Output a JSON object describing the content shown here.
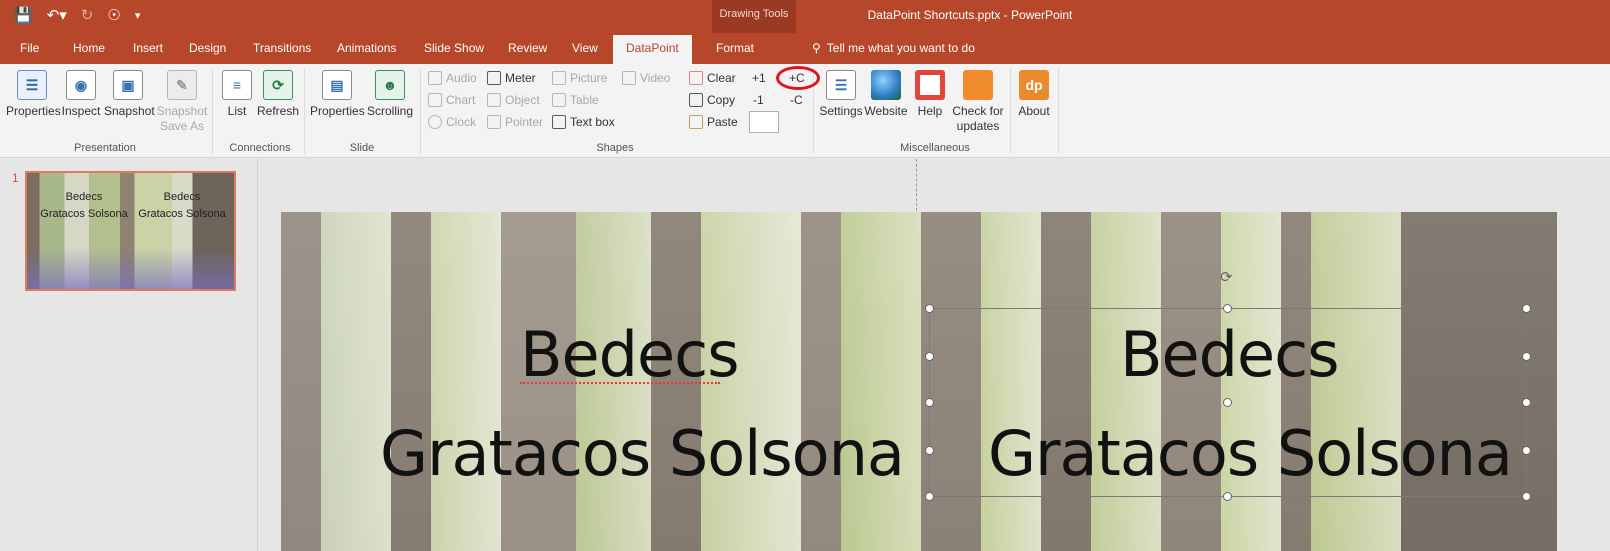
{
  "titlebar": {
    "qat_icons": [
      "save-icon",
      "undo-icon",
      "redo-icon",
      "touch-mode-icon",
      "customize-icon"
    ],
    "context_group": "Drawing Tools",
    "document_title": "DataPoint Shortcuts.pptx - PowerPoint"
  },
  "tabs": {
    "file": "File",
    "home": "Home",
    "insert": "Insert",
    "design": "Design",
    "transitions": "Transitions",
    "animations": "Animations",
    "slideshow": "Slide Show",
    "review": "Review",
    "view": "View",
    "datapoint": "DataPoint",
    "format": "Format",
    "tellme": "Tell me what you want to do"
  },
  "ribbon": {
    "presentation": {
      "label": "Presentation",
      "properties": "Properties",
      "inspect": "Inspect",
      "snapshot": "Snapshot",
      "snapshot_saveas_1": "Snapshot",
      "snapshot_saveas_2": "Save As"
    },
    "connections": {
      "label": "Connections",
      "list": "List",
      "refresh": "Refresh"
    },
    "slide": {
      "label": "Slide",
      "properties": "Properties",
      "scrolling": "Scrolling"
    },
    "shapes": {
      "label": "Shapes",
      "audio": "Audio",
      "chart": "Chart",
      "clock": "Clock",
      "meter": "Meter",
      "object": "Object",
      "pointer": "Pointer",
      "picture": "Picture",
      "table": "Table",
      "textbox": "Text box",
      "video": "Video",
      "clear": "Clear",
      "copy": "Copy",
      "paste": "Paste",
      "plus1": "+1",
      "minus1": "-1",
      "plusC": "+C",
      "minusC": "-C"
    },
    "misc": {
      "label": "Miscellaneous",
      "settings": "Settings",
      "website": "Website",
      "help": "Help",
      "check_1": "Check for",
      "check_2": "updates",
      "about": "About",
      "about_logo": "dp"
    }
  },
  "thumbnails": {
    "number": "1",
    "text_a_1": "Bedecs",
    "text_a_2": "Gratacos Solsona",
    "text_b_1": "Bedecs",
    "text_b_2": "Gratacos Solsona"
  },
  "slide": {
    "left_line1": "Bedecs",
    "left_line2": "Gratacos Solsona",
    "right_line1": "Bedecs",
    "right_line2": "Gratacos Solsona"
  },
  "colors": {
    "accent": "#b7472a",
    "highlight_ring": "#e1141b"
  }
}
